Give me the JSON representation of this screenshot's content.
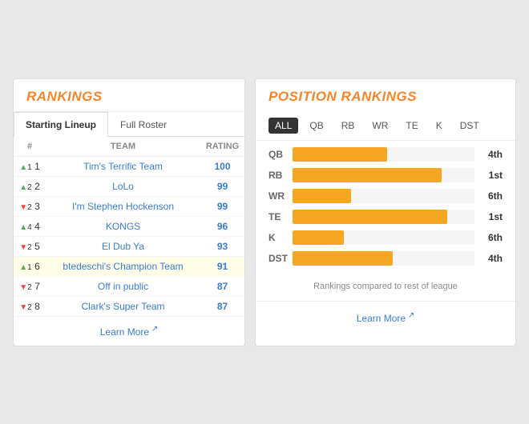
{
  "left": {
    "title": "RANKINGS",
    "tabs": [
      {
        "label": "Starting Lineup",
        "active": true
      },
      {
        "label": "Full Roster",
        "active": false
      }
    ],
    "table": {
      "headers": [
        "#",
        "TEAM",
        "RATING"
      ],
      "rows": [
        {
          "rank": 1,
          "change": "up",
          "change_num": 1,
          "team": "Tim's Terrific Team",
          "rating": 100,
          "highlighted": false
        },
        {
          "rank": 2,
          "change": "up",
          "change_num": 2,
          "team": "LoLo",
          "rating": 99,
          "highlighted": false
        },
        {
          "rank": 3,
          "change": "down",
          "change_num": 2,
          "team": "I'm Stephen Hockenson",
          "rating": 99,
          "highlighted": false
        },
        {
          "rank": 4,
          "change": "up",
          "change_num": 4,
          "team": "KONGS",
          "rating": 96,
          "highlighted": false
        },
        {
          "rank": 5,
          "change": "down",
          "change_num": 2,
          "team": "El Dub Ya",
          "rating": 93,
          "highlighted": false
        },
        {
          "rank": 6,
          "change": "up",
          "change_num": 1,
          "team": "btedeschi's Champion Team",
          "rating": 91,
          "highlighted": true
        },
        {
          "rank": 7,
          "change": "down",
          "change_num": 2,
          "team": "Off in public",
          "rating": 87,
          "highlighted": false
        },
        {
          "rank": 8,
          "change": "down",
          "change_num": 2,
          "team": "Clark's Super Team",
          "rating": 87,
          "highlighted": false
        }
      ]
    },
    "learn_more": "Learn More"
  },
  "right": {
    "title": "POSITION RANKINGS",
    "filters": [
      "ALL",
      "QB",
      "RB",
      "WR",
      "TE",
      "K",
      "DST"
    ],
    "active_filter": "ALL",
    "positions": [
      {
        "label": "QB",
        "bar_pct": 52,
        "rank": "4th"
      },
      {
        "label": "RB",
        "bar_pct": 82,
        "rank": "1st"
      },
      {
        "label": "WR",
        "bar_pct": 32,
        "rank": "6th"
      },
      {
        "label": "TE",
        "bar_pct": 85,
        "rank": "1st"
      },
      {
        "label": "K",
        "bar_pct": 28,
        "rank": "6th"
      },
      {
        "label": "DST",
        "bar_pct": 55,
        "rank": "4th"
      }
    ],
    "note": "Rankings compared to rest of league",
    "learn_more": "Learn More"
  }
}
